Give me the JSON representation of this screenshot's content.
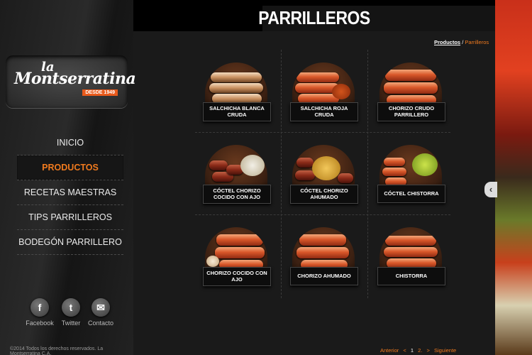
{
  "brand": {
    "la": "la",
    "name": "Montserratina",
    "tagline": "DESDE 1949"
  },
  "nav": [
    {
      "label": "INICIO"
    },
    {
      "label": "PRODUCTOS"
    },
    {
      "label": "RECETAS MAESTRAS"
    },
    {
      "label": "TIPS PARRILLEROS"
    },
    {
      "label": "BODEGÓN PARRILLERO"
    }
  ],
  "social": [
    {
      "label": "Facebook",
      "icon": "facebook-icon",
      "glyph": "f"
    },
    {
      "label": "Twitter",
      "icon": "twitter-icon",
      "glyph": "t"
    },
    {
      "label": "Contacto",
      "icon": "mail-icon",
      "glyph": "✉"
    }
  ],
  "copyright": "©2014 Todos los derechos reservados. La Montserratina C.A.",
  "page": {
    "title": "PARRILLEROS"
  },
  "breadcrumb": {
    "parent": "Productos",
    "separator": "/",
    "current": "Parrilleros"
  },
  "products": [
    {
      "name": "SALCHICHA BLANCA CRUDA"
    },
    {
      "name": "SALCHICHA ROJA CRUDA"
    },
    {
      "name": "CHORIZO CRUDO PARRILLERO"
    },
    {
      "name": "CÓCTEL CHORIZO COCIDO CON AJO"
    },
    {
      "name": "CÓCTEL CHORIZO AHUMADO"
    },
    {
      "name": "CÓCTEL CHISTORRA"
    },
    {
      "name": "CHORIZO COCIDO CON AJO"
    },
    {
      "name": "CHORIZO AHUMADO"
    },
    {
      "name": "CHISTORRA"
    }
  ],
  "pager": {
    "prev": "Anterior",
    "prev_arrow": "<",
    "page1": "1",
    "page2": "2.",
    "next_arrow": ">",
    "next": "Siguiente"
  },
  "colors": {
    "accent": "#f07a1e",
    "background": "#1a1a1a",
    "label_bg": "#0d0d0d"
  }
}
